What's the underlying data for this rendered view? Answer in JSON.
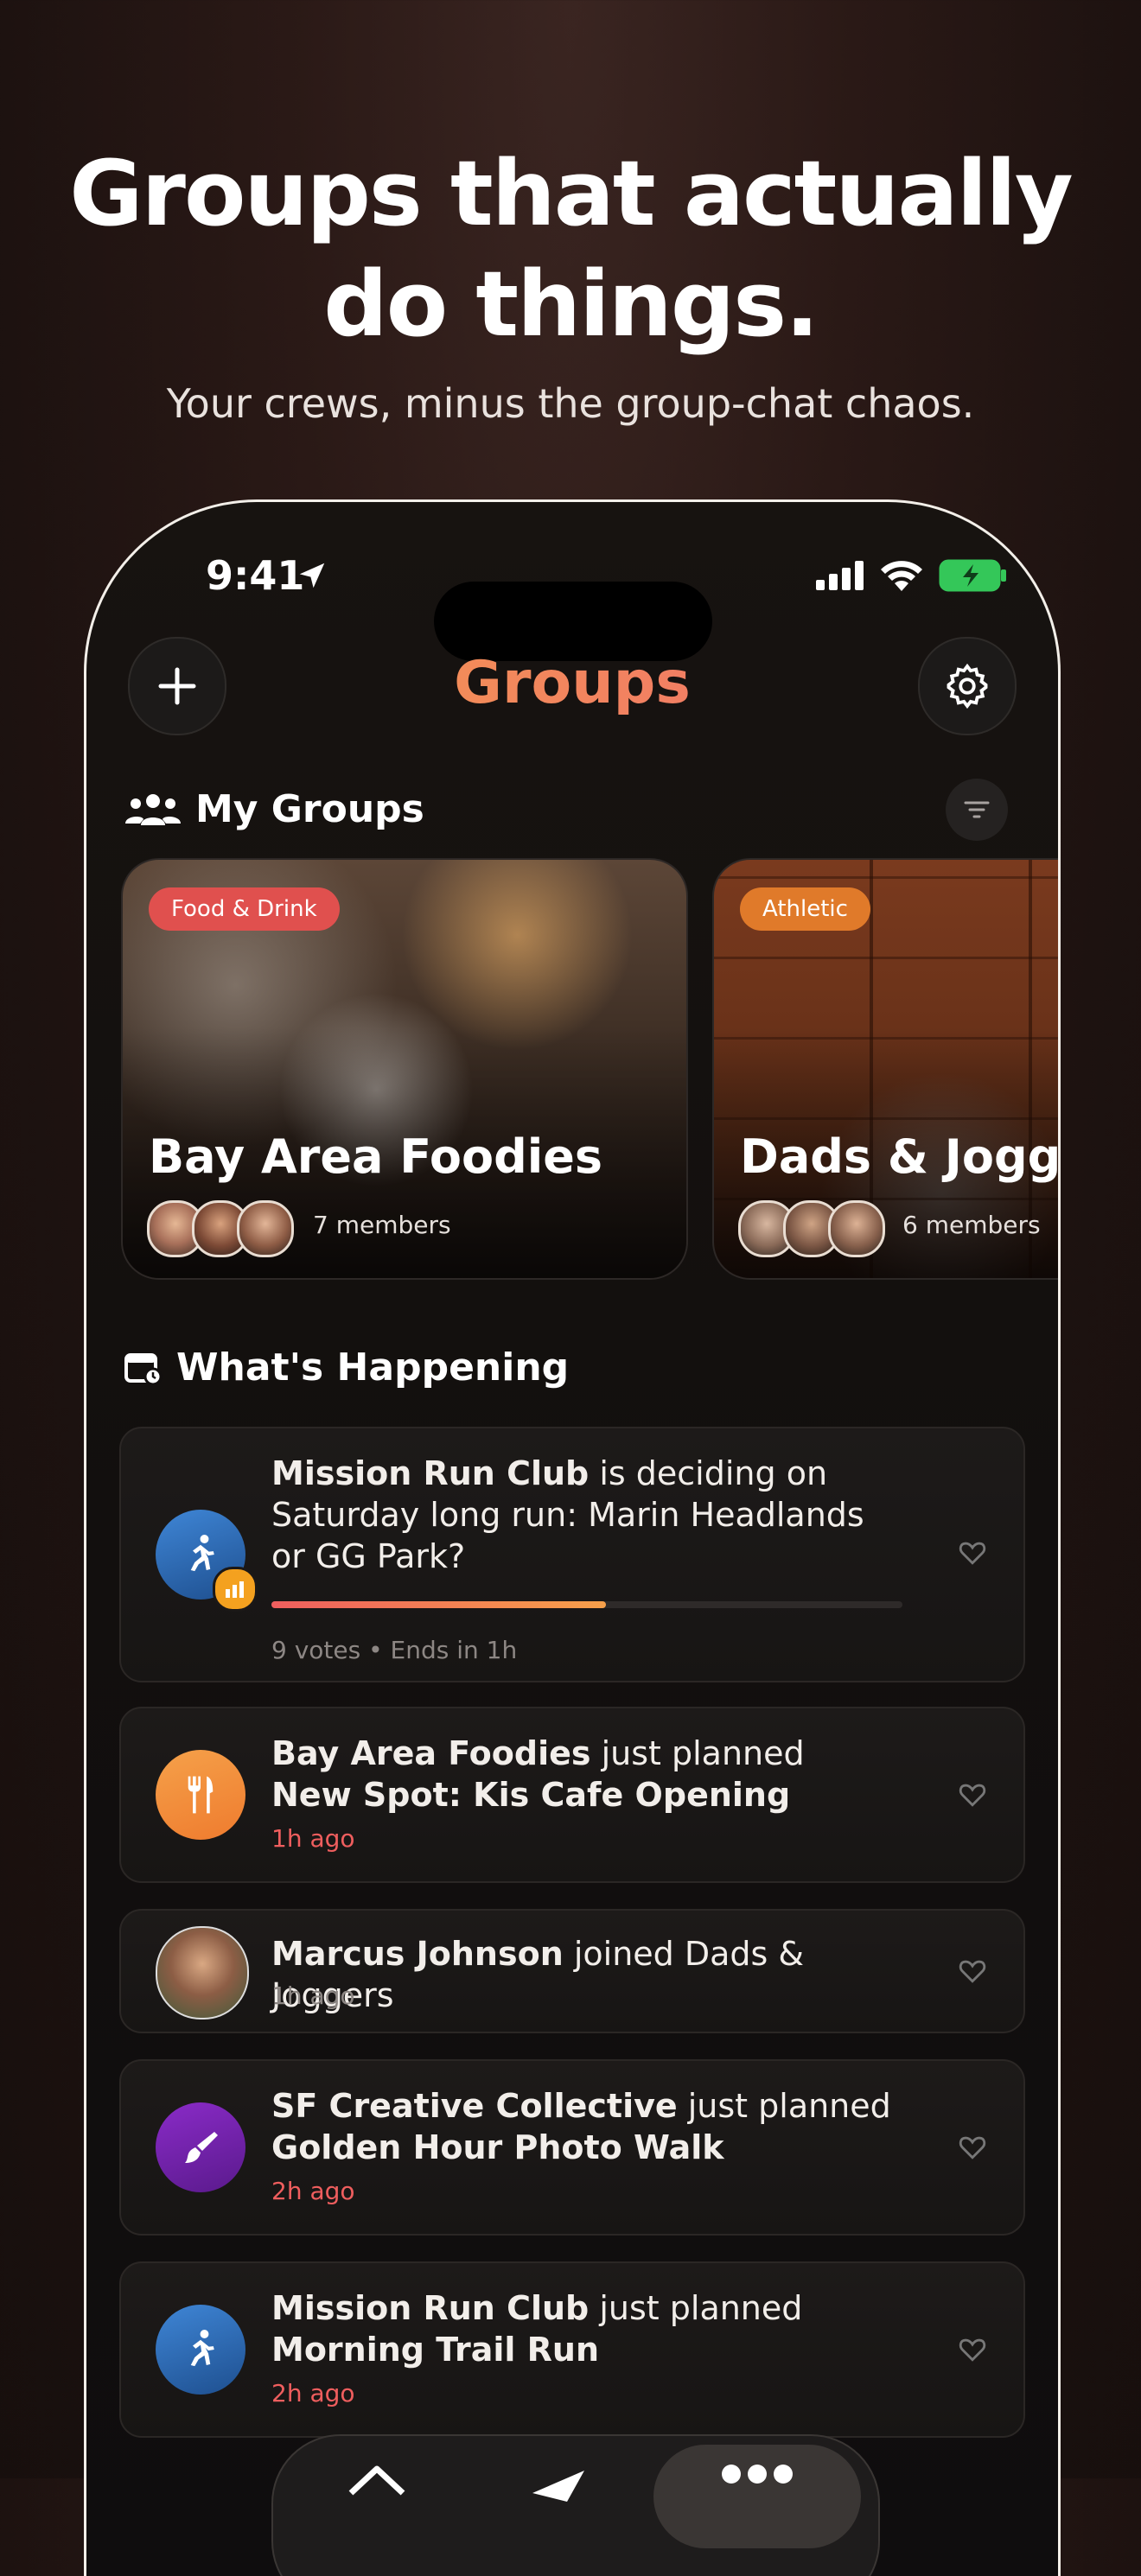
{
  "headline": {
    "line1": "Groups that actually",
    "line2": "do things."
  },
  "subheadline": "Your crews, minus the group-chat chaos.",
  "status_bar": {
    "time": "9:41"
  },
  "header": {
    "title": "Groups",
    "add_icon": "plus-icon",
    "settings_icon": "gear-icon"
  },
  "my_groups": {
    "heading": "My Groups",
    "groups": [
      {
        "category": "Food & Drink",
        "name": "Bay Area Foodies",
        "members": "7 members"
      },
      {
        "category": "Athletic",
        "name": "Dads & Joggers",
        "members": "6 members"
      }
    ]
  },
  "whats_happening": {
    "heading": "What's Happening",
    "items": [
      {
        "group": "Mission Run Club",
        "action": " is deciding on Saturday long run: Marin Headlands or GG Park?",
        "meta": "9 votes • Ends in 1h",
        "progress": 0.53
      },
      {
        "group": "Bay Area Foodies",
        "action": " just planned ",
        "event": "New Spot: Kis Cafe Opening",
        "meta": "1h ago"
      },
      {
        "group": "Marcus Johnson",
        "action": " joined Dads & Joggers",
        "meta": "1h ago"
      },
      {
        "group": "SF Creative Collective",
        "action": " just planned ",
        "event": "Golden Hour Photo Walk",
        "meta": "2h ago"
      },
      {
        "group": "Mission Run Club",
        "action": " just planned ",
        "event": "Morning Trail Run",
        "meta": "2h ago"
      }
    ]
  },
  "colors": {
    "accent_orange": "#f6a04a",
    "accent_pink": "#ee6a72",
    "time_red": "#ef5e5e"
  }
}
